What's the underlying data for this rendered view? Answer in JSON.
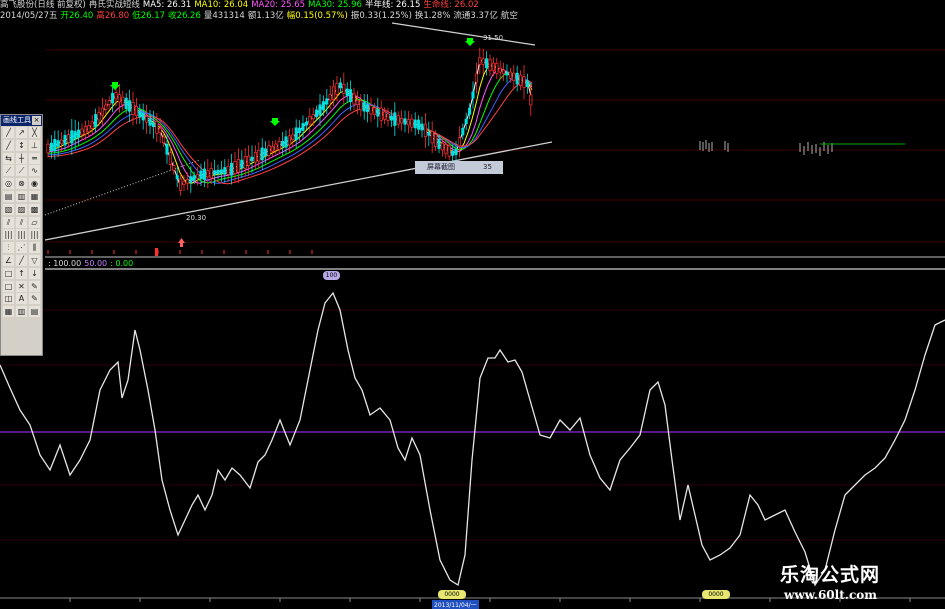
{
  "header": {
    "line1": [
      {
        "text": "高飞股份(日线 前复权)",
        "color": "#d8d8d8"
      },
      {
        "text": "冉氏实战短线",
        "color": "#d8d8d8"
      },
      {
        "text": "MA5: 26.31",
        "color": "#ffffff"
      },
      {
        "text": "MA10: 26.04",
        "color": "#ffff00"
      },
      {
        "text": "MA20: 25.65",
        "color": "#ff55ff"
      },
      {
        "text": "MA30: 25.96",
        "color": "#00ff00"
      },
      {
        "text": "半年线: 26.15",
        "color": "#ffffff"
      },
      {
        "text": "生命线: 26.02",
        "color": "#ff4040"
      }
    ],
    "line2": [
      {
        "text": "2014/05/27五",
        "color": "#d8d8d8"
      },
      {
        "text": "开26.40",
        "color": "#00ff00"
      },
      {
        "text": "高26.80",
        "color": "#ff4040"
      },
      {
        "text": "低26.17",
        "color": "#00ff00"
      },
      {
        "text": "收26.26",
        "color": "#00ff00"
      },
      {
        "text": "量431314",
        "color": "#d8d8d8"
      },
      {
        "text": "额1.13亿",
        "color": "#d8d8d8"
      },
      {
        "text": "幅0.15(0.57%)",
        "color": "#ffff00"
      },
      {
        "text": "振0.33(1.25%)",
        "color": "#d8d8d8"
      },
      {
        "text": "换1.28%",
        "color": "#d8d8d8"
      },
      {
        "text": "流通3.37亿",
        "color": "#d8d8d8"
      },
      {
        "text": "航空",
        "color": "#d8d8d8"
      }
    ]
  },
  "price_labels": {
    "high": "31.50",
    "low": "20.30"
  },
  "screenshot_box": {
    "title": "屏幕截图",
    "value": "35"
  },
  "toolbox": {
    "title": "画线工具",
    "close": "×",
    "tools": [
      "╱",
      "↗",
      "╳",
      "╱",
      "↕",
      "⊥",
      "⇆",
      "┼",
      "═",
      "⟋",
      "⟋",
      "∿",
      "◎",
      "⊗",
      "◉",
      "▤",
      "▥",
      "▦",
      "▧",
      "▨",
      "▩",
      "⫽",
      "⫽",
      "▱",
      "|||",
      "|||",
      "|||",
      "⫶",
      "⋰",
      "⫼",
      "∠",
      "╱",
      "▽",
      "□",
      "↑",
      "↓",
      "□",
      "✕",
      "✎",
      "◫",
      "A",
      "✎",
      "▦",
      "▥",
      "▤"
    ]
  },
  "indicator": {
    "labels": [
      {
        "text": ": 100.00",
        "color": "#d8d8d8"
      },
      {
        "text": "50.00",
        "color": "#c080ff"
      },
      {
        "text": ": 0.00",
        "color": "#00ff00"
      }
    ],
    "top_tag": "100",
    "bottom_tag_left": "0000",
    "bottom_tag_right": "0000"
  },
  "date_axis": {
    "highlight": "2013/11/04/一"
  },
  "watermark": {
    "title": "乐淘公式网",
    "url": "www.60lt.com"
  }
}
